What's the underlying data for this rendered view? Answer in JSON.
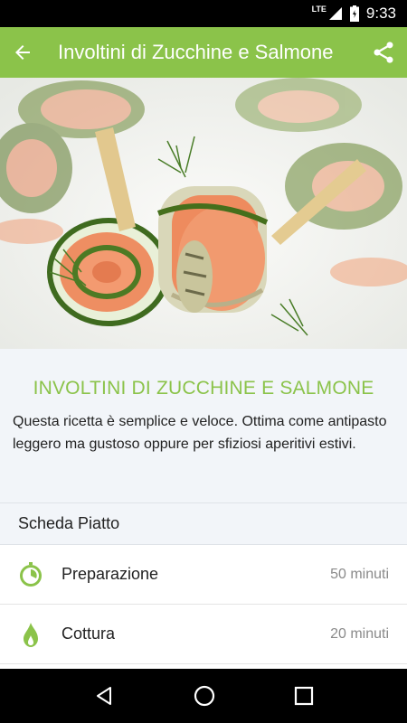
{
  "status_bar": {
    "network": "LTE",
    "time": "9:33"
  },
  "app_bar": {
    "title": "Involtini di Zucchine e Salmone",
    "back_icon": "arrow-back-icon",
    "share_icon": "share-icon"
  },
  "recipe": {
    "title": "INVOLTINI DI ZUCCHINE E SALMONE",
    "description": "Questa ricetta è semplice e veloce. Ottima come antipasto leggero ma gustoso oppure per sfiziosi aperitivi estivi."
  },
  "sheet": {
    "header": "Scheda Piatto",
    "items": [
      {
        "label": "Preparazione",
        "value": "50 minuti",
        "icon": "timer-icon"
      },
      {
        "label": "Cottura",
        "value": "20 minuti",
        "icon": "flame-icon"
      }
    ]
  },
  "colors": {
    "accent": "#8bc34a",
    "background": "#f2f5f9"
  }
}
